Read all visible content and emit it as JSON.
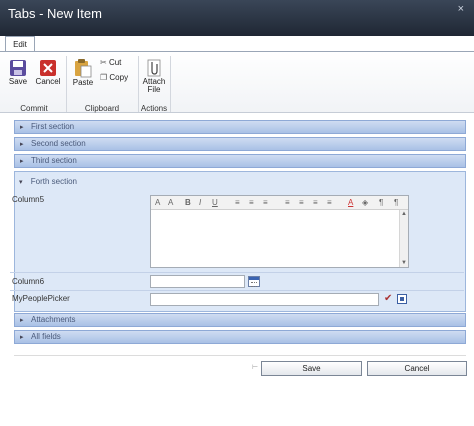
{
  "window": {
    "title": "Tabs - New Item",
    "close_glyph": "×"
  },
  "ribbon": {
    "tab_label": "Edit",
    "commit": {
      "label": "Commit",
      "save": "Save",
      "cancel": "Cancel"
    },
    "clipboard": {
      "label": "Clipboard",
      "paste": "Paste",
      "cut": "Cut",
      "copy": "Copy"
    },
    "actions": {
      "label": "Actions",
      "attach_line1": "Attach",
      "attach_line2": "File"
    }
  },
  "sections": [
    {
      "label": "First section"
    },
    {
      "label": "Second section"
    },
    {
      "label": "Third section"
    },
    {
      "label": "Forth section"
    },
    {
      "label": "Attachments"
    },
    {
      "label": "All fields"
    }
  ],
  "fields": {
    "column5": {
      "label": "Column5",
      "value": ""
    },
    "column6": {
      "label": "Column6",
      "value": ""
    },
    "people": {
      "label": "MyPeoplePicker",
      "value": ""
    }
  },
  "rte_toolbar": [
    "A",
    "A",
    "B",
    "I",
    "U",
    "≡",
    "≡",
    "≡",
    "≡",
    "≡",
    "≡",
    "≡",
    "A",
    "◈",
    "¶",
    "¶"
  ],
  "footer": {
    "save": "Save",
    "cancel": "Cancel"
  }
}
